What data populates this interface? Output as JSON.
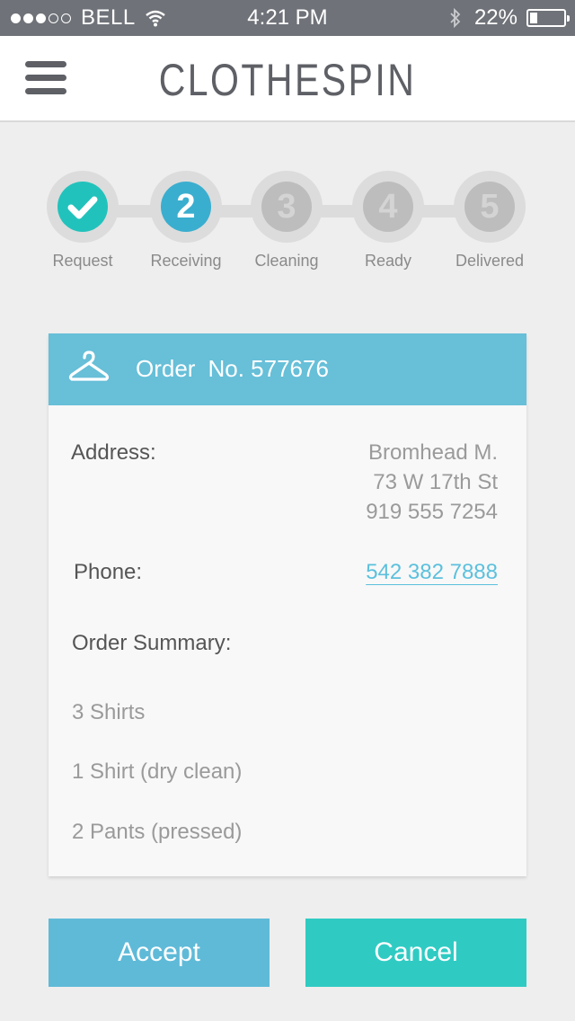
{
  "status_bar": {
    "carrier": "BELL",
    "signal_full": 3,
    "signal_empty": 2,
    "time": "4:21 PM",
    "battery_percent": "22%",
    "battery_level": 0.22
  },
  "header": {
    "menu_icon": "hamburger-menu-icon",
    "title": "CLOTHESPIN"
  },
  "steps": [
    {
      "number": "",
      "label": "Request",
      "state": "done"
    },
    {
      "number": "2",
      "label": "Receiving",
      "state": "active"
    },
    {
      "number": "3",
      "label": "Cleaning",
      "state": "pending"
    },
    {
      "number": "4",
      "label": "Ready",
      "state": "pending"
    },
    {
      "number": "5",
      "label": "Delivered",
      "state": "pending"
    }
  ],
  "order": {
    "icon": "hanger-icon",
    "label": "Order",
    "number": "No. 577676",
    "address_label": "Address:",
    "address_lines": [
      "Bromhead M.",
      "73 W 17th St",
      "919 555 7254"
    ],
    "phone_label": "Phone:",
    "phone": "542 382 7888",
    "summary_label": "Order Summary:",
    "summary_items": [
      "3 Shirts",
      "1 Shirt (dry clean)",
      "2 Pants (pressed)"
    ]
  },
  "actions": {
    "accept": "Accept",
    "cancel": "Cancel"
  },
  "colors": {
    "status_bar": "#6f7278",
    "done": "#22c2bc",
    "active": "#3aaecf",
    "header": "#67bfd8",
    "accept": "#5fbad8",
    "cancel": "#2fcbc3"
  }
}
